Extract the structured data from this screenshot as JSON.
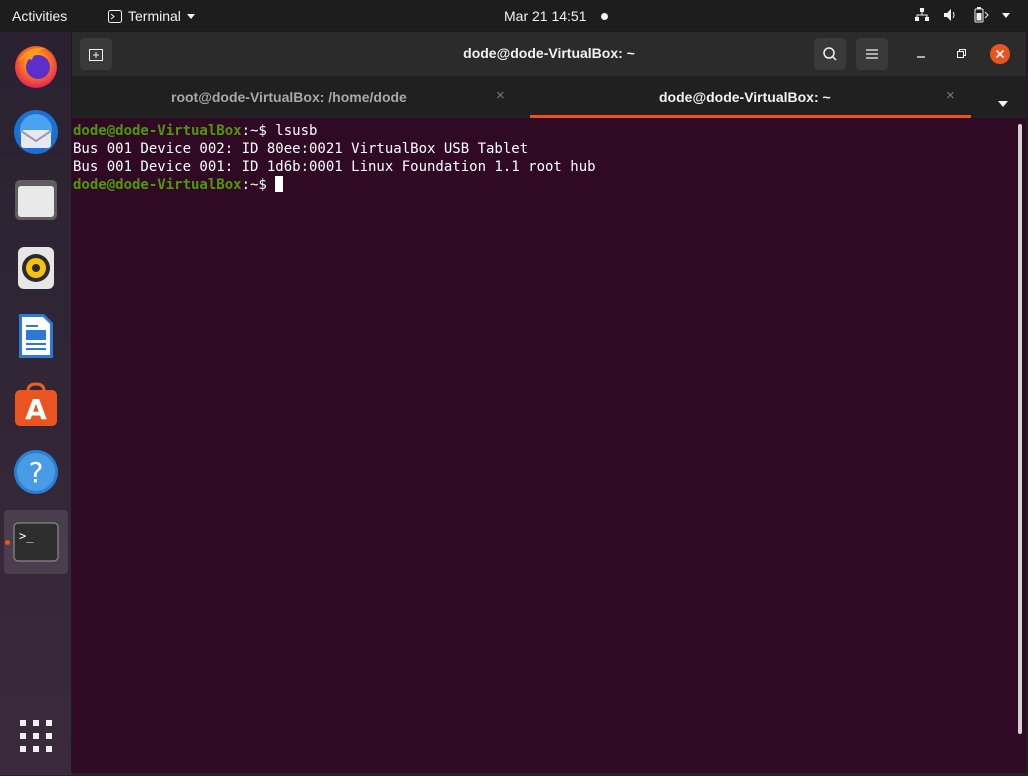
{
  "topbar": {
    "activities": "Activities",
    "app_menu": "Terminal",
    "datetime": "Mar 21  14:51"
  },
  "dock": {
    "items": [
      {
        "name": "firefox-icon"
      },
      {
        "name": "thunderbird-icon"
      },
      {
        "name": "files-icon"
      },
      {
        "name": "rhythmbox-icon"
      },
      {
        "name": "libreoffice-writer-icon"
      },
      {
        "name": "ubuntu-software-icon"
      },
      {
        "name": "help-icon"
      },
      {
        "name": "terminal-icon",
        "active": true
      }
    ],
    "help_glyph": "?",
    "software_glyph": "A",
    "terminal_glyph": ">_"
  },
  "window": {
    "title": "dode@dode-VirtualBox: ~",
    "tabs": [
      {
        "label": "root@dode-VirtualBox: /home/dode",
        "close": "×"
      },
      {
        "label": "dode@dode-VirtualBox: ~",
        "close": "×",
        "active": true
      }
    ]
  },
  "terminal": {
    "prompt_user": "dode@dode-VirtualBox",
    "prompt_suffix": ":~$ ",
    "command": "lsusb",
    "output": [
      "Bus 001 Device 002: ID 80ee:0021 VirtualBox USB Tablet",
      "Bus 001 Device 001: ID 1d6b:0001 Linux Foundation 1.1 root hub"
    ]
  },
  "colors": {
    "terminal_bg": "#300a24",
    "accent": "#e95420",
    "prompt": "#4e9a06"
  }
}
